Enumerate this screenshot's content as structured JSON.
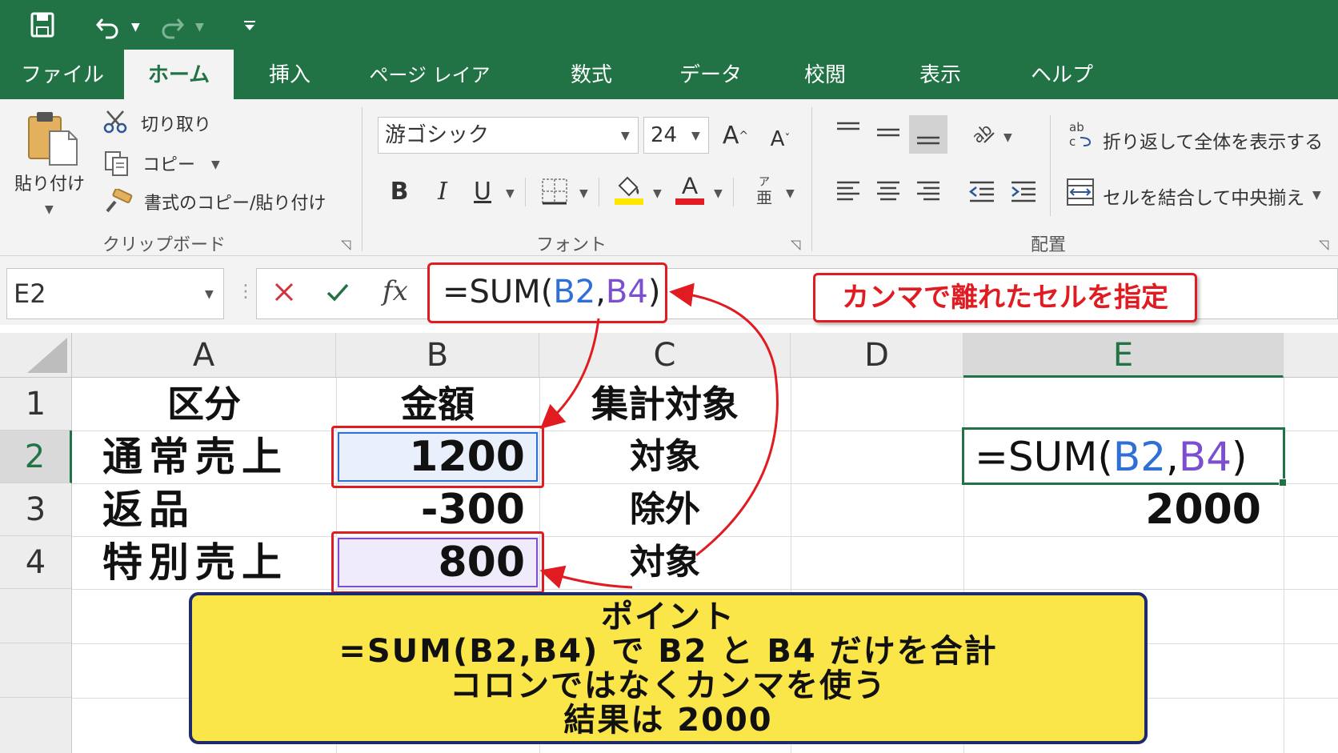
{
  "quick_access": {
    "save_icon": "save-icon",
    "undo_icon": "undo-icon",
    "redo_icon": "redo-icon",
    "customize_icon": "customize-icon"
  },
  "tabs": [
    {
      "label": "ファイル"
    },
    {
      "label": "ホーム"
    },
    {
      "label": "挿入"
    },
    {
      "label": "ページ レイアウト"
    },
    {
      "label": "数式"
    },
    {
      "label": "データ"
    },
    {
      "label": "校閲"
    },
    {
      "label": "表示"
    },
    {
      "label": "ヘルプ"
    }
  ],
  "ribbon": {
    "clipboard": {
      "paste": "貼り付け",
      "cut": "切り取り",
      "copy": "コピー",
      "format_painter": "書式のコピー/貼り付け",
      "group": "クリップボード"
    },
    "font": {
      "font_name": "游ゴシック",
      "font_size": "24",
      "bold": "B",
      "italic": "I",
      "underline": "U",
      "group": "フォント"
    },
    "alignment": {
      "wrap_text": "折り返して全体を表示する",
      "merge_center": "セルを結合して中央揃え",
      "group": "配置"
    },
    "colors": {
      "highlight": "#ffe600",
      "font_color": "#e01b22"
    }
  },
  "formula_bar": {
    "name_box": "E2",
    "formula_prefix": "=SUM(",
    "ref1": "B2",
    "comma": ",",
    "ref2": "B4",
    "formula_suffix": ")"
  },
  "callout_red": "カンマで離れたセルを指定",
  "sheet": {
    "columns": [
      "A",
      "B",
      "C",
      "D",
      "E"
    ],
    "rows": [
      "1",
      "2",
      "3",
      "4"
    ],
    "cells": {
      "A1": "区分",
      "B1": "金額",
      "C1": "集計対象",
      "A2": "通常売上",
      "B2": "1200",
      "C2": "対象",
      "A3": "返品",
      "B3": "-300",
      "C3": "除外",
      "A4": "特別売上",
      "B4": "800",
      "C4": "対象",
      "E3": "2000"
    },
    "E2_formula": {
      "prefix": "=SUM(",
      "ref1": "B2",
      "comma": ",",
      "ref2": "B4",
      "suffix": ")"
    }
  },
  "point_box": {
    "line1": "ポイント",
    "line2": "=SUM(B2,B4) で B2 と B4 だけを合計",
    "line3": "コロンではなくカンマを使う",
    "line4": "結果は 2000"
  },
  "accent_colors": {
    "excel_green": "#217346",
    "ref_blue": "#2f6fd6",
    "ref_purple": "#7b4fd0",
    "annotation_red": "#e01b22",
    "note_yellow": "#fbe64a"
  }
}
